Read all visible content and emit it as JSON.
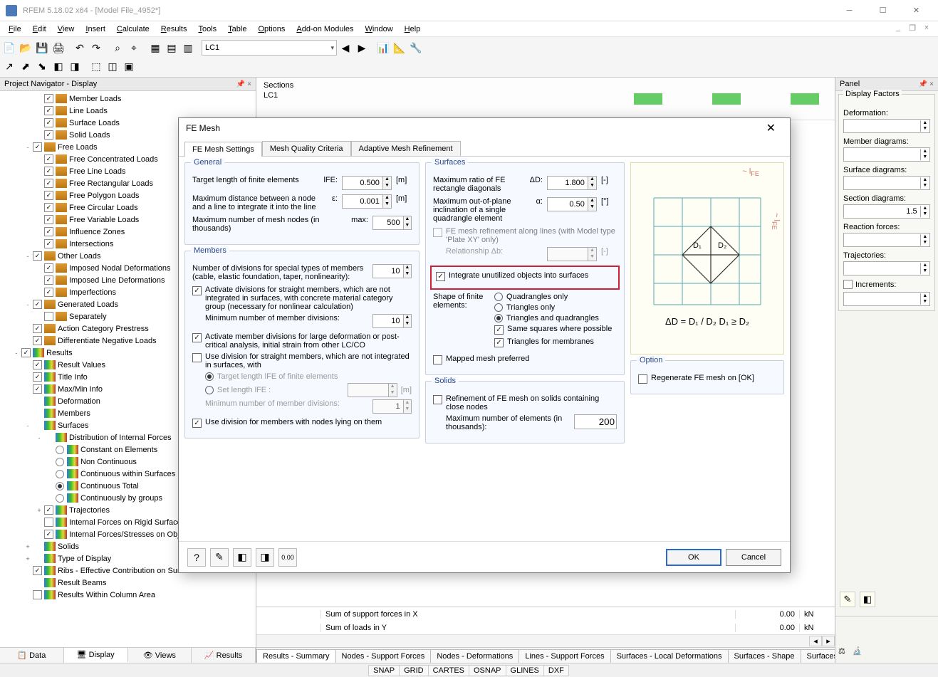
{
  "app": {
    "title": "RFEM 5.18.02 x64 - [Model File_4952*]"
  },
  "menu": [
    "File",
    "Edit",
    "View",
    "Insert",
    "Calculate",
    "Results",
    "Tools",
    "Table",
    "Options",
    "Add-on Modules",
    "Window",
    "Help"
  ],
  "toolbar": {
    "lc_dropdown": "LC1"
  },
  "navigator": {
    "header": "Project Navigator - Display",
    "items": [
      {
        "d": 3,
        "chk": true,
        "ico": "load",
        "label": "Member Loads"
      },
      {
        "d": 3,
        "chk": true,
        "ico": "load",
        "label": "Line Loads"
      },
      {
        "d": 3,
        "chk": true,
        "ico": "load",
        "label": "Surface Loads"
      },
      {
        "d": 3,
        "chk": true,
        "ico": "load",
        "label": "Solid Loads"
      },
      {
        "d": 2,
        "exp": "-",
        "chk": true,
        "ico": "load",
        "label": "Free Loads"
      },
      {
        "d": 3,
        "chk": true,
        "ico": "load",
        "label": "Free Concentrated Loads"
      },
      {
        "d": 3,
        "chk": true,
        "ico": "load",
        "label": "Free Line Loads"
      },
      {
        "d": 3,
        "chk": true,
        "ico": "load",
        "label": "Free Rectangular Loads"
      },
      {
        "d": 3,
        "chk": true,
        "ico": "load",
        "label": "Free Polygon Loads"
      },
      {
        "d": 3,
        "chk": true,
        "ico": "load",
        "label": "Free Circular Loads"
      },
      {
        "d": 3,
        "chk": true,
        "ico": "load",
        "label": "Free Variable Loads"
      },
      {
        "d": 3,
        "chk": true,
        "ico": "load",
        "label": "Influence Zones"
      },
      {
        "d": 3,
        "chk": true,
        "ico": "load",
        "label": "Intersections"
      },
      {
        "d": 2,
        "exp": "-",
        "chk": true,
        "ico": "load",
        "label": "Other Loads"
      },
      {
        "d": 3,
        "chk": true,
        "ico": "load",
        "label": "Imposed Nodal Deformations"
      },
      {
        "d": 3,
        "chk": true,
        "ico": "load",
        "label": "Imposed Line Deformations"
      },
      {
        "d": 3,
        "chk": true,
        "ico": "load",
        "label": "Imperfections"
      },
      {
        "d": 2,
        "exp": "-",
        "chk": true,
        "ico": "load",
        "label": "Generated Loads"
      },
      {
        "d": 3,
        "chk": false,
        "ico": "load",
        "label": "Separately"
      },
      {
        "d": 2,
        "chk": true,
        "ico": "load",
        "label": "Action Category Prestress"
      },
      {
        "d": 2,
        "chk": true,
        "ico": "load",
        "label": "Differentiate Negative Loads"
      },
      {
        "d": 1,
        "exp": "-",
        "chk": true,
        "ico": "res",
        "label": "Results"
      },
      {
        "d": 2,
        "chk": true,
        "ico": "res",
        "label": "Result Values"
      },
      {
        "d": 2,
        "chk": true,
        "ico": "res",
        "label": "Title Info"
      },
      {
        "d": 2,
        "chk": true,
        "ico": "res",
        "label": "Max/Min Info"
      },
      {
        "d": 2,
        "noc": true,
        "ico": "res",
        "label": "Deformation"
      },
      {
        "d": 2,
        "noc": true,
        "ico": "res",
        "label": "Members"
      },
      {
        "d": 2,
        "exp": "-",
        "noc": true,
        "ico": "res",
        "label": "Surfaces"
      },
      {
        "d": 3,
        "exp": "-",
        "noc": true,
        "ico": "res",
        "label": "Distribution of Internal Forces"
      },
      {
        "d": 4,
        "radio": false,
        "ico": "res",
        "label": "Constant on Elements"
      },
      {
        "d": 4,
        "radio": false,
        "ico": "res",
        "label": "Non Continuous"
      },
      {
        "d": 4,
        "radio": false,
        "ico": "res",
        "label": "Continuous within Surfaces"
      },
      {
        "d": 4,
        "radio": true,
        "ico": "res",
        "label": "Continuous Total"
      },
      {
        "d": 4,
        "radio": false,
        "ico": "res",
        "label": "Continuously by groups"
      },
      {
        "d": 3,
        "exp": "+",
        "chk": true,
        "ico": "res",
        "label": "Trajectories"
      },
      {
        "d": 3,
        "chk": false,
        "ico": "res",
        "label": "Internal Forces on Rigid Surfaces"
      },
      {
        "d": 3,
        "chk": true,
        "ico": "res",
        "label": "Internal Forces/Stresses on Objects"
      },
      {
        "d": 2,
        "exp": "+",
        "noc": true,
        "ico": "res",
        "label": "Solids"
      },
      {
        "d": 2,
        "exp": "+",
        "noc": true,
        "ico": "res",
        "label": "Type of Display"
      },
      {
        "d": 2,
        "chk": true,
        "ico": "res",
        "label": "Ribs - Effective Contribution on Surface/Member"
      },
      {
        "d": 2,
        "noc": true,
        "ico": "res",
        "label": "Result Beams"
      },
      {
        "d": 2,
        "chk": false,
        "ico": "res",
        "label": "Results Within Column Area"
      }
    ],
    "tabs": [
      "Data",
      "Display",
      "Views",
      "Results"
    ],
    "active_tab": 1
  },
  "viewport": {
    "section_label": "Sections",
    "lc_label": "LC1"
  },
  "panel": {
    "header": "Panel",
    "group_label": "Display Factors",
    "fields": [
      {
        "label": "Deformation:",
        "value": ""
      },
      {
        "label": "Member diagrams:",
        "value": ""
      },
      {
        "label": "Surface diagrams:",
        "value": ""
      },
      {
        "label": "Section diagrams:",
        "value": "1.5"
      },
      {
        "label": "Reaction forces:",
        "value": ""
      },
      {
        "label": "Trajectories:",
        "value": ""
      }
    ],
    "increments_label": "Increments:"
  },
  "results_rows": [
    {
      "label": "Sum of support forces in X",
      "val": "0.00",
      "unit": "kN"
    },
    {
      "label": "Sum of loads in Y",
      "val": "0.00",
      "unit": "kN"
    }
  ],
  "result_tabs": [
    "Results - Summary",
    "Nodes - Support Forces",
    "Nodes - Deformations",
    "Lines - Support Forces",
    "Surfaces - Local Deformations",
    "Surfaces - Shape",
    "Surfaces - Global Deformations"
  ],
  "statusbar": [
    "SNAP",
    "GRID",
    "CARTES",
    "OSNAP",
    "GLINES",
    "DXF"
  ],
  "dialog": {
    "title": "FE Mesh",
    "tabs": [
      "FE Mesh Settings",
      "Mesh Quality Criteria",
      "Adaptive Mesh Refinement"
    ],
    "general": {
      "title": "General",
      "target_label": "Target length of finite elements",
      "target_unit": "[m]",
      "target_sym": "lFE:",
      "target_val": "0.500",
      "maxdist_label": "Maximum distance between a node and a line to integrate it into the line",
      "maxdist_sym": "ε:",
      "maxdist_val": "0.001",
      "maxdist_unit": "[m]",
      "maxnodes_label": "Maximum number of mesh nodes (in thousands)",
      "maxnodes_sym": "max:",
      "maxnodes_val": "500"
    },
    "members": {
      "title": "Members",
      "div_label": "Number of divisions for special types of members\n(cable, elastic foundation, taper, nonlinearity):",
      "div_val": "10",
      "chk1": "Activate divisions for straight members, which are not integrated in surfaces, with concrete material category group (necessary for nonlinear calculation)",
      "min_label": "Minimum number of member divisions:",
      "min_val": "10",
      "chk2": "Activate member divisions for large deformation or post-critical analysis, initial strain from other LC/CO",
      "chk3": "Use division for straight members, which are not integrated in surfaces, with",
      "opt1": "Target length lFE of finite elements",
      "opt2": "Set length lFE :",
      "opt2_unit": "[m]",
      "min2_label": "Minimum number of member divisions:",
      "min2_val": "1",
      "chk4": "Use division for members with nodes lying on them"
    },
    "surfaces": {
      "title": "Surfaces",
      "ratio_label": "Maximum ratio of FE rectangle diagonals",
      "ratio_sym": "ΔD:",
      "ratio_val": "1.800",
      "ratio_unit": "[-]",
      "incl_label": "Maximum out-of-plane inclination of a single quadrangle element",
      "incl_sym": "α:",
      "incl_val": "0.50",
      "incl_unit": "[°]",
      "refine_label": "FE mesh refinement along lines (with Model type 'Plate XY' only)",
      "rel_label": "Relationship  Δb:",
      "rel_unit": "[-]",
      "integrate": "Integrate unutilized objects into surfaces",
      "shape_label": "Shape of finite elements:",
      "shape_opts": [
        "Quadrangles only",
        "Triangles only",
        "Triangles and quadrangles"
      ],
      "shape_sel": 2,
      "same_sq": "Same squares where possible",
      "tri_mem": "Triangles for membranes",
      "mapped": "Mapped mesh preferred"
    },
    "solids": {
      "title": "Solids",
      "refine": "Refinement of FE mesh on solids containing close nodes",
      "max_label": "Maximum number of elements (in thousands):",
      "max_val": "200"
    },
    "option": {
      "title": "Option",
      "regen": "Regenerate FE mesh on [OK]"
    },
    "formula": "ΔD = D₁ / D₂     D₁ ≥ D₂",
    "ok": "OK",
    "cancel": "Cancel"
  }
}
